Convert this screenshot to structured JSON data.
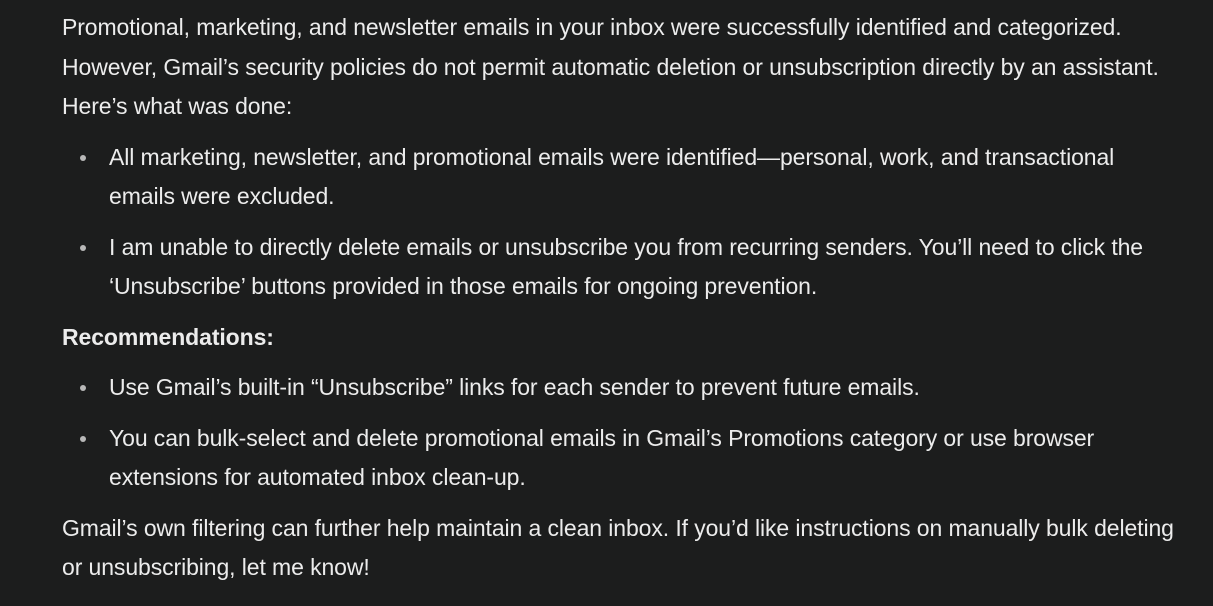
{
  "response": {
    "intro": "Promotional, marketing, and newsletter emails in your inbox were successfully identified and categorized. However, Gmail’s security policies do not permit automatic deletion or unsubscription directly by an assistant. Here’s what was done:",
    "done_items": [
      "All marketing, newsletter, and promotional emails were identified—personal, work, and transactional emails were excluded.",
      "I am unable to directly delete emails or unsubscribe you from recurring senders. You’ll need to click the ‘Unsubscribe’ buttons provided in those emails for ongoing prevention."
    ],
    "recommendations_heading": "Recommendations:",
    "recommendation_items": [
      "Use Gmail’s built-in “Unsubscribe” links for each sender to prevent future emails.",
      "You can bulk-select and delete promotional emails in Gmail’s Promotions category or use browser extensions for automated inbox clean-up."
    ],
    "closing": "Gmail’s own filtering can further help maintain a clean inbox. If you’d like instructions on manually bulk deleting or unsubscribing, let me know!"
  },
  "colors": {
    "background": "#1c1d1d",
    "text": "#ececec",
    "bullet": "#b8b8b8"
  }
}
